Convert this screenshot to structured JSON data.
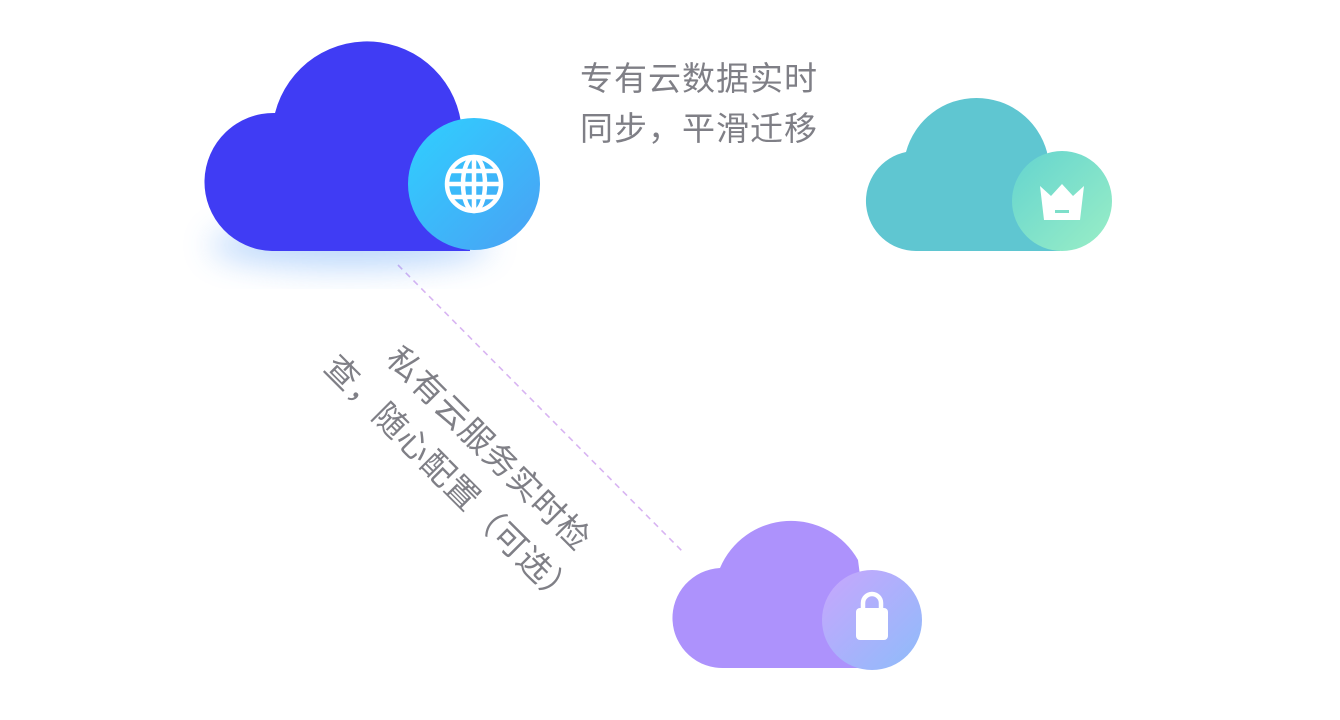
{
  "diagram": {
    "nodes": [
      {
        "id": "main",
        "icon": "globe-icon",
        "cloud_color": "#403cf4",
        "badge_colors": [
          "#31c8fd",
          "#4aa5f5"
        ]
      },
      {
        "id": "dedicated",
        "icon": "crown-icon",
        "cloud_color": "#5fc6d1",
        "badge_colors": [
          "#6ad8cc",
          "#96ecc5"
        ]
      },
      {
        "id": "private",
        "icon": "lock-icon",
        "cloud_color": "#ad92fc",
        "badge_colors": [
          "#c3a9fd",
          "#8fb9fb"
        ]
      }
    ],
    "edges": [
      {
        "from": "main",
        "to": "dedicated",
        "style": "double-solid",
        "colors": [
          "#5b4ef0",
          "#7fe6f3"
        ]
      },
      {
        "from": "main",
        "to": "private",
        "style": "dashed",
        "colors": [
          "#d9b5f3"
        ]
      }
    ],
    "labels": {
      "sync_line1": "专有云数据实时",
      "sync_line2": "同步，平滑迁移",
      "check_line1": "私有云服务实时检",
      "check_line2": "查，随心配置（可选）"
    }
  }
}
